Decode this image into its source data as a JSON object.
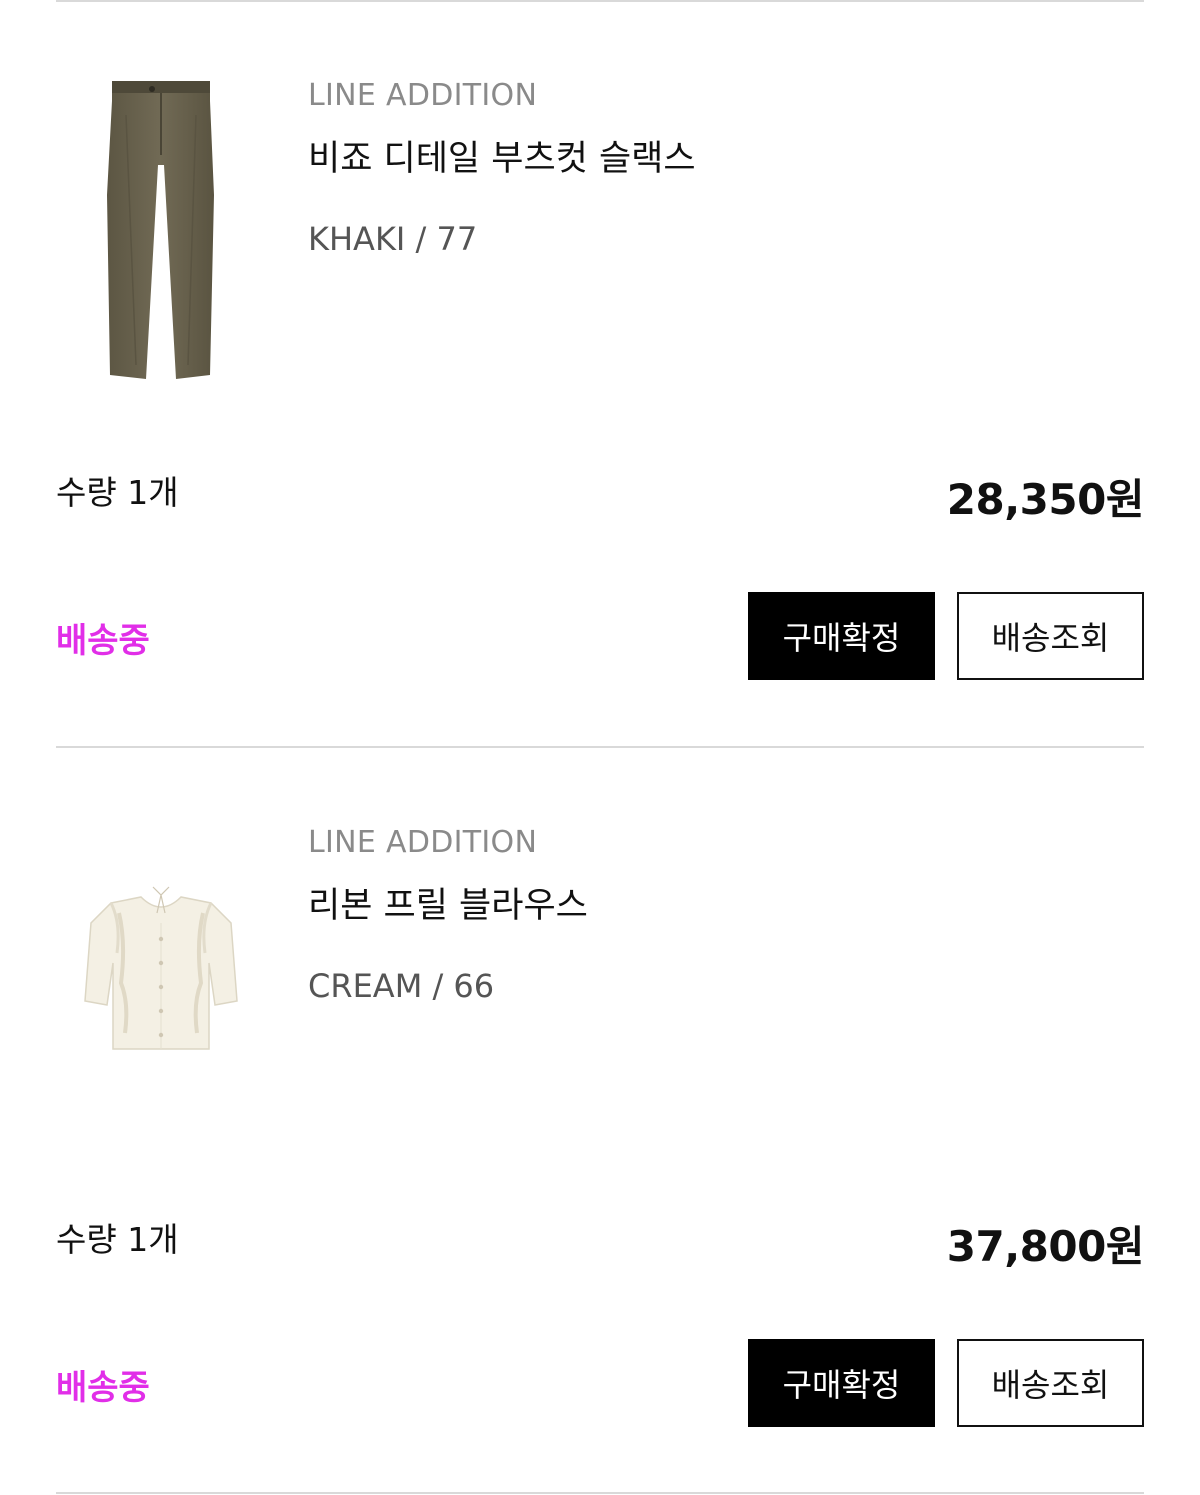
{
  "orders": [
    {
      "brand": "LINE ADDITION",
      "title": "비죠 디테일 부츠컷 슬랙스",
      "option": "KHAKI / 77",
      "quantity": "수량 1개",
      "price": "28,350원",
      "status": "배송중",
      "confirm_label": "구매확정",
      "track_label": "배송조회",
      "thumbnail_icon": "khaki-slacks-image",
      "thumbnail_color": "#6b6550"
    },
    {
      "brand": "LINE ADDITION",
      "title": "리본 프릴 블라우스",
      "option": "CREAM / 66",
      "quantity": "수량 1개",
      "price": "37,800원",
      "status": "배송중",
      "confirm_label": "구매확정",
      "track_label": "배송조회",
      "thumbnail_icon": "cream-blouse-image",
      "thumbnail_color": "#f4f0e4"
    }
  ],
  "colors": {
    "status": "#e12ee8",
    "primary_button_bg": "#000000",
    "divider": "#d9d9d9"
  }
}
